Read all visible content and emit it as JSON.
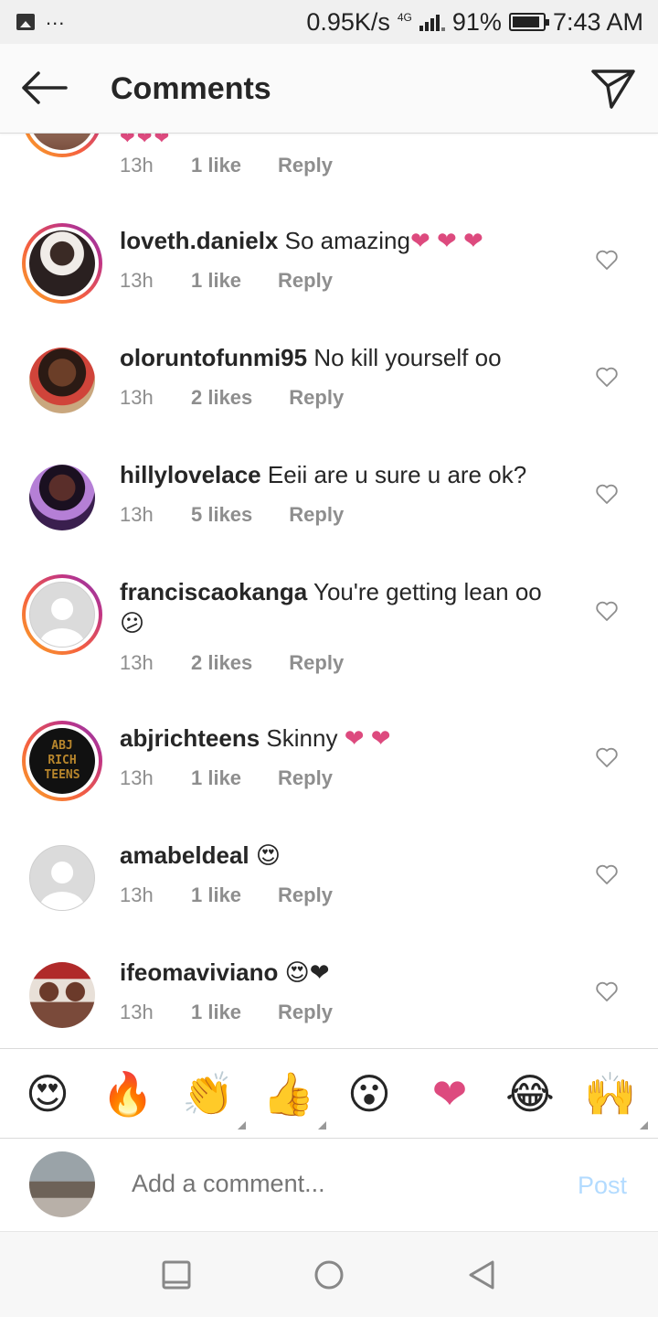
{
  "status_bar": {
    "speed": "0.95K/s",
    "network": "4G",
    "battery_percent": "91%",
    "battery_level": 0.91,
    "time": "7:43 AM",
    "notif_dots": "..."
  },
  "header": {
    "title": "Comments"
  },
  "partial_comment": {
    "hearts": "❤❤❤",
    "time": "13h",
    "likes": "1 like",
    "reply": "Reply"
  },
  "comments": [
    {
      "username": "loveth.danielx",
      "text": "So amazing",
      "emoji": "❤ ❤ ❤",
      "time": "13h",
      "likes": "1 like",
      "reply": "Reply"
    },
    {
      "username": "oloruntofunmi95",
      "text": "No kill yourself oo",
      "emoji": "",
      "time": "13h",
      "likes": "2 likes",
      "reply": "Reply"
    },
    {
      "username": "hillylovelace",
      "text": "Eeii are u sure u are ok?",
      "emoji": "",
      "time": "13h",
      "likes": "5 likes",
      "reply": "Reply"
    },
    {
      "username": "franciscaokanga",
      "text": "You're getting lean oo",
      "emoji": "😕",
      "time": "13h",
      "likes": "2 likes",
      "reply": "Reply"
    },
    {
      "username": "abjrichteens",
      "text": "Skinny",
      "emoji": "❤ ❤",
      "time": "13h",
      "likes": "1 like",
      "reply": "Reply"
    },
    {
      "username": "amabeldeal",
      "text": "",
      "emoji": "😍",
      "time": "13h",
      "likes": "1 like",
      "reply": "Reply"
    },
    {
      "username": "ifeomaviviano",
      "text": "",
      "emoji": "😍❤",
      "time": "13h",
      "likes": "1 like",
      "reply": "Reply"
    }
  ],
  "avatar_text": {
    "abjrichteens": "ABJ RICH TEENS"
  },
  "emoji_bar": [
    "😍",
    "🔥",
    "👏",
    "👍",
    "😮",
    "❤",
    "😂",
    "🙌"
  ],
  "composer": {
    "placeholder": "Add a comment...",
    "post_label": "Post"
  },
  "colors": {
    "accent_pink": "#dd4a7e",
    "post_disabled": "#b3dbff",
    "meta_gray": "#8e8e8e"
  }
}
